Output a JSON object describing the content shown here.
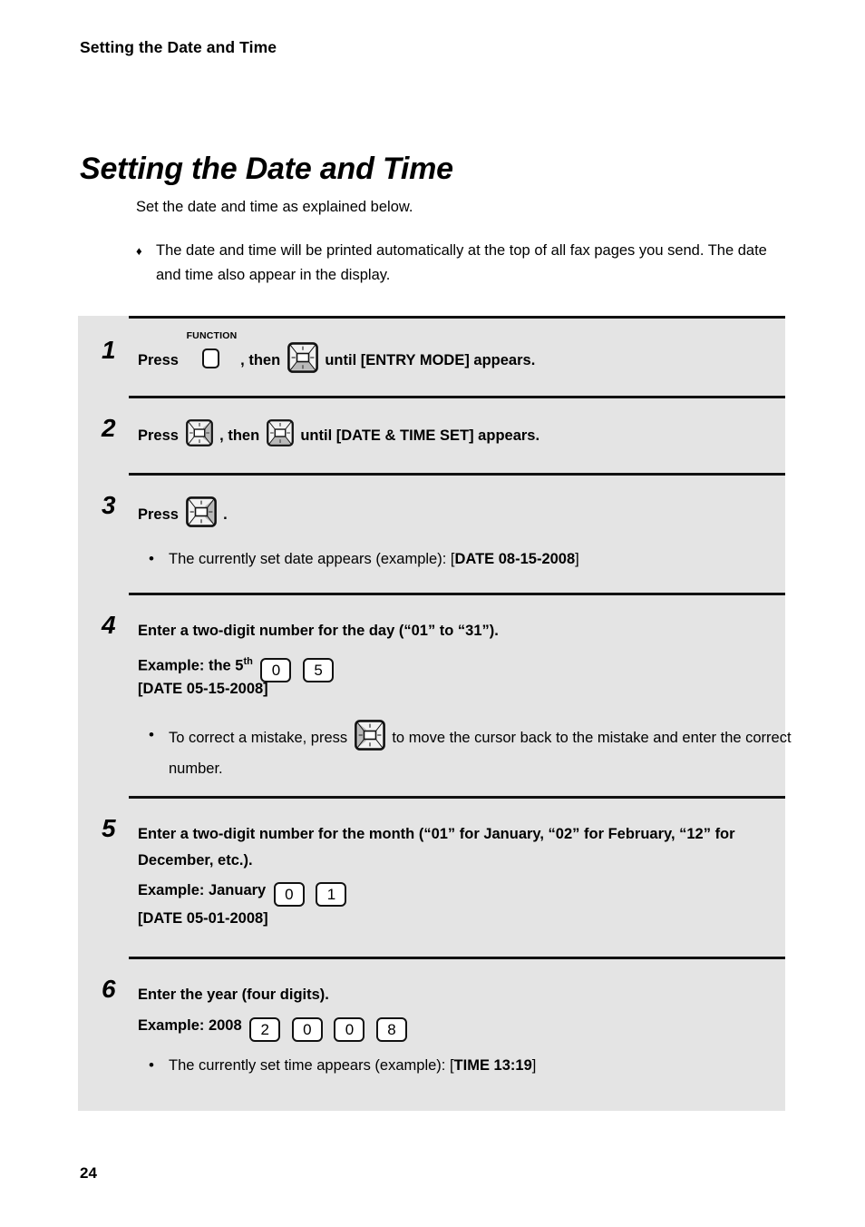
{
  "header": {
    "running_title": "Setting the Date and Time"
  },
  "title": "Setting the Date and Time",
  "intro": {
    "lead": "Set the date and time as explained below.",
    "diamond_marker": "♦",
    "note": "The date and time will be printed automatically at the top of all fax pages you send. The date and time also appear in the display."
  },
  "icons": {
    "function_key_label": "FUNCTION",
    "up_arrow": "up-arrow-key-icon",
    "down_arrow": "down-arrow-key-icon",
    "left_arrow": "left-arrow-key-icon",
    "right_arrow": "right-arrow-key-icon"
  },
  "bullet_marker": "•",
  "steps": [
    {
      "number": "1",
      "text_a": "Press",
      "text_b": ", then",
      "text_c": "until [ENTRY MODE] appears."
    },
    {
      "number": "2",
      "text_a": "Press",
      "text_b": ", then",
      "text_c": "until [DATE & TIME SET] appears."
    },
    {
      "number": "3",
      "text_a": "Press",
      "text_b": ".",
      "bullet_pre": "The currently set date appears (example): [",
      "bullet_strong": "DATE 08-15-2008",
      "bullet_post": "]"
    },
    {
      "number": "4",
      "instruction": "Enter a two-digit number for the day (“01” to “31”).",
      "example_label": "Example: the 5",
      "example_ordinal": "th",
      "keys": [
        "0",
        "5"
      ],
      "result": "[DATE 05-15-2008]",
      "bullet_pre": "To correct a mistake, press",
      "bullet_post": "to move the cursor back to the mistake and enter the correct number."
    },
    {
      "number": "5",
      "instruction": "Enter a two-digit number for the month (“01” for January, “02” for February, “12” for December, etc.).",
      "example_label": "Example: January",
      "keys": [
        "0",
        "1"
      ],
      "result": "[DATE 05-01-2008]"
    },
    {
      "number": "6",
      "instruction": "Enter the year (four digits).",
      "example_label": "Example: 2008",
      "keys": [
        "2",
        "0",
        "0",
        "8"
      ],
      "bullet_pre": "The currently set time appears (example): [",
      "bullet_strong": "TIME 13:19",
      "bullet_post": "]"
    }
  ],
  "footer": {
    "page_number": "24"
  },
  "colors": {
    "panel_background": "#e4e4e4",
    "rule": "#111111",
    "page_background": "#ffffff",
    "text": "#000000"
  }
}
